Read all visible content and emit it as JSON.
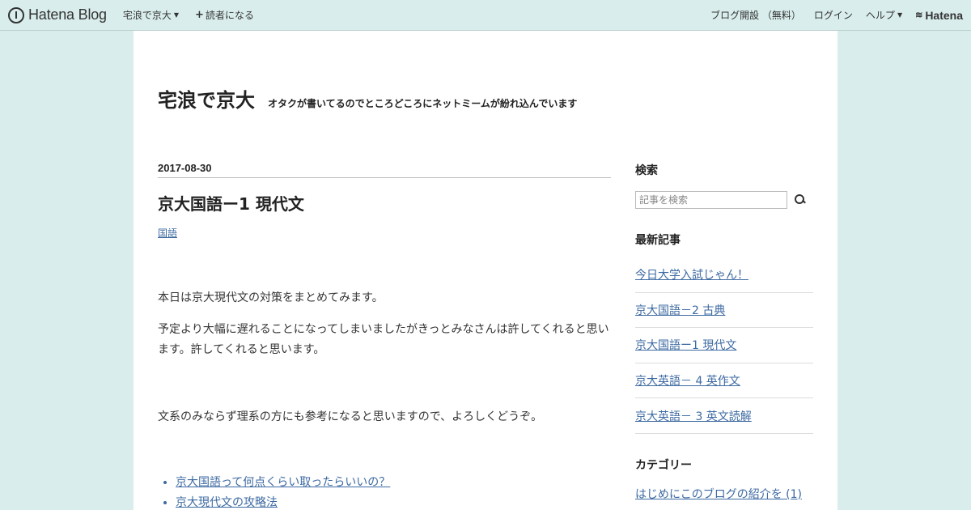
{
  "topbar": {
    "logo_text": "Hatena Blog",
    "blog_menu": "宅浪で京大",
    "subscribe": "読者になる",
    "open_blog": "ブログ開設 （無料）",
    "login": "ログイン",
    "help": "ヘルプ",
    "hatena": "Hatena"
  },
  "blog": {
    "title": "宅浪で京大",
    "description": "オタクが書いてるのでところどころにネットミームが紛れ込んでいます"
  },
  "article": {
    "date": "2017-08-30",
    "title": "京大国語ー1 現代文",
    "category": "国語",
    "paragraphs": [
      "本日は京大現代文の対策をまとめてみます。",
      "予定より大幅に遅れることになってしまいましたがきっとみなさんは許してくれると思います。許してくれると思います。",
      "文系のみならず理系の方にも参考になると思いますので、よろしくどうぞ。"
    ],
    "toc": [
      "京大国語って何点くらい取ったらいいの？",
      "京大現代文の攻略法"
    ]
  },
  "sidebar": {
    "search_heading": "検索",
    "search_placeholder": "記事を検索",
    "recent_heading": "最新記事",
    "recent": [
      "今日大学入試じゃん！",
      "京大国語－2 古典",
      "京大国語ー1 現代文",
      "京大英語－ 4  英作文",
      "京大英語－ 3  英文読解"
    ],
    "category_heading": "カテゴリー",
    "categories": [
      "はじめにこのブログの紹介を (1)"
    ]
  }
}
